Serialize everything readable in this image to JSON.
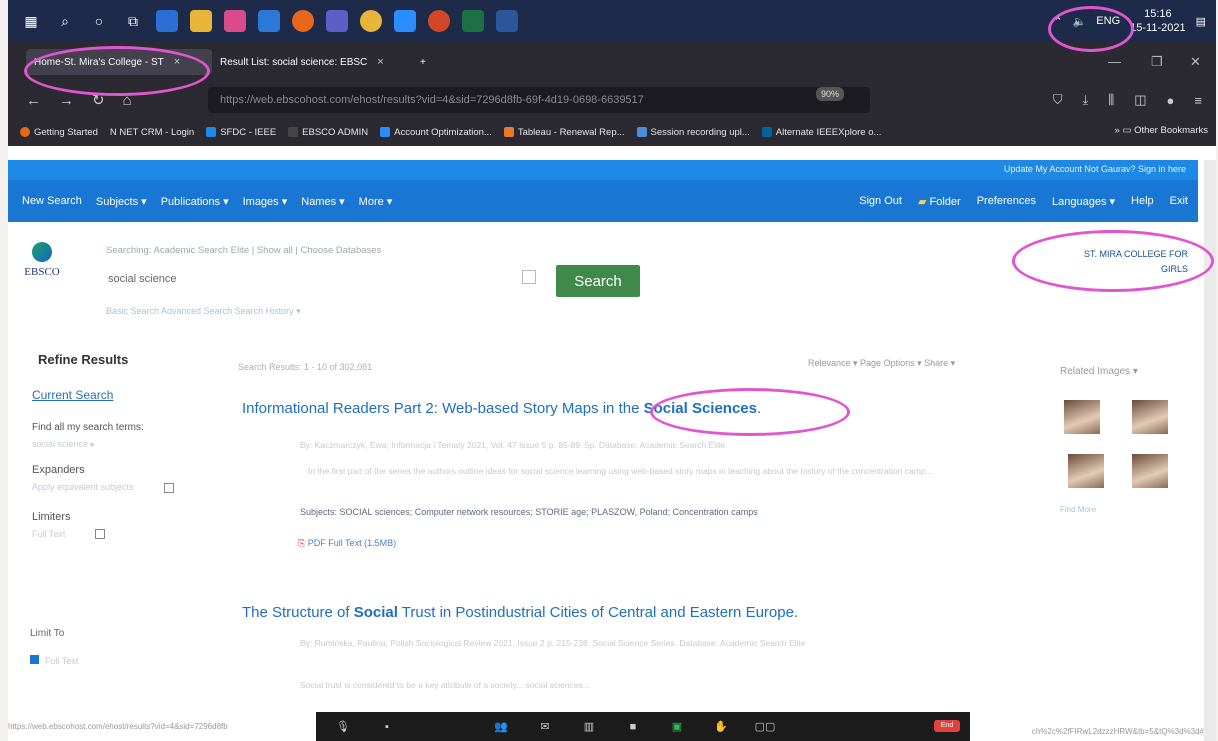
{
  "taskbar": {
    "lang": "ENG",
    "time": "15:16",
    "date": "15-11-2021"
  },
  "tabs": [
    {
      "label": "Home-St. Mira's College - ST",
      "close": "×"
    },
    {
      "label": "Result List: social science: EBSC",
      "close": "×"
    }
  ],
  "newtab": "+",
  "nav": {
    "url": "https://web.ebscohost.com/ehost/results?vid=4&sid=7296d8fb-69f-4d19-0698-6639517",
    "zoom": "90%"
  },
  "bookmarks": [
    "Getting Started",
    "N NET CRM - Login",
    "SFDC - IEEE",
    "EBSCO ADMIN",
    "Account Optimization...",
    "Tableau - Renewal Rep...",
    "Session recording upl...",
    "Alternate IEEEXplore o..."
  ],
  "bookmarks_other": "Other Bookmarks",
  "ebsco": {
    "util_links": "Update My Account   Not Gaurav?  Sign in here",
    "menu_left": [
      "New Search",
      "Subjects ▾",
      "Publications ▾",
      "Images ▾",
      "Names ▾",
      "More ▾"
    ],
    "menu_right": [
      "Sign Out",
      "Folder",
      "Preferences",
      "Languages ▾",
      "Help",
      "Exit"
    ],
    "logo_text": "EBSCO",
    "searching": "Searching: Academic Search Elite | Show all | Choose Databases",
    "query": "social science",
    "search_btn": "Search",
    "search_opts": "Basic Search   Advanced Search   Search History ▾",
    "college_line1": "ST. MIRA COLLEGE FOR",
    "college_line2": "GIRLS"
  },
  "sidebar": {
    "title": "Refine Results",
    "current_search": "Current Search",
    "find_all": "Find all my search terms:",
    "find_all_value": "social science ▸",
    "expanders": "Expanders",
    "expander_item": "Apply equivalent subjects",
    "limiters": "Limiters",
    "limiter_item": "Full Text",
    "limit_to": "Limit To",
    "full_text": "Full Text"
  },
  "results": {
    "info": "Search Results: 1 - 10 of 302,081",
    "sort": "Relevance ▾   Page Options ▾   Share ▾",
    "items": [
      {
        "title_pre": "Informational Readers Part 2: Web-based Story Maps in the ",
        "title_hl": "Social Sciences",
        "title_post": ".",
        "meta": "By: Kaczmarczyk, Ewa; Informacja i Tematy 2021, Vol. 47 Issue 5 p. 85-89. 5p. Database: Academic Search Elite",
        "abstract": "In the first part of the series the authors outline ideas for social science learning using web-based story maps in teaching about the history of the concentration camp...",
        "subjects": "Subjects: SOCIAL sciences;  Computer network resources;  STORIE age;  PLASZOW, Poland;  Concentration camps",
        "pdf": "PDF Full Text (1.5MB)"
      },
      {
        "title_pre": "The Structure of ",
        "title_hl": "Social",
        "title_post": " Trust in Postindustrial Cities of Central and Eastern Europe.",
        "meta": "By: Rumińska, Paulina; Polish Sociological Review 2021, Issue 2 p. 215-238. Social Science Series. Database: Academic Search Elite",
        "abstract": "Social trust is considered to be a key attribute of a society... social sciences..."
      }
    ]
  },
  "related": {
    "title": "Related Images ▾",
    "find_more": "Find More"
  },
  "status_url": "https://web.ebscohost.com/ehost/results?vid=4&sid=7296d8fb",
  "status_url_right": "ch%2c%2fFIRwL2dzzzHRW&tb=5&tQ%3d%3d#"
}
